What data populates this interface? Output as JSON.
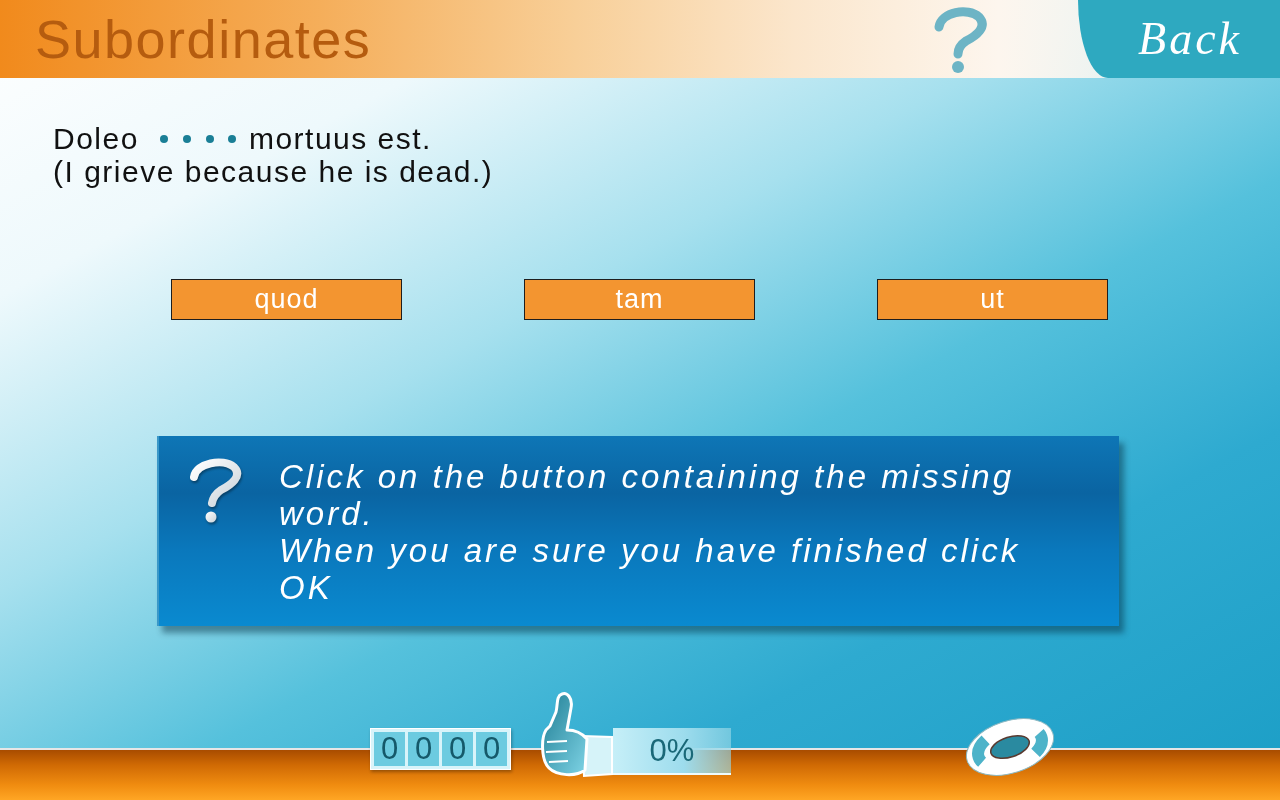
{
  "header": {
    "title": "Subordinates",
    "back_button": "Back"
  },
  "sentence": {
    "before_blank": "Doleo",
    "after_blank": "mortuus est.",
    "translation": "(I grieve because he is dead.)"
  },
  "options": [
    {
      "label": "quod",
      "selected": false
    },
    {
      "label": "tam",
      "selected": false
    },
    {
      "label": "ut",
      "selected": false
    }
  ],
  "instructions": [
    "Click on the button containing the missing word.",
    "When you are sure you have finished click OK"
  ],
  "score": {
    "digits": [
      "0",
      "0",
      "0",
      "0"
    ],
    "percent": "0%"
  }
}
